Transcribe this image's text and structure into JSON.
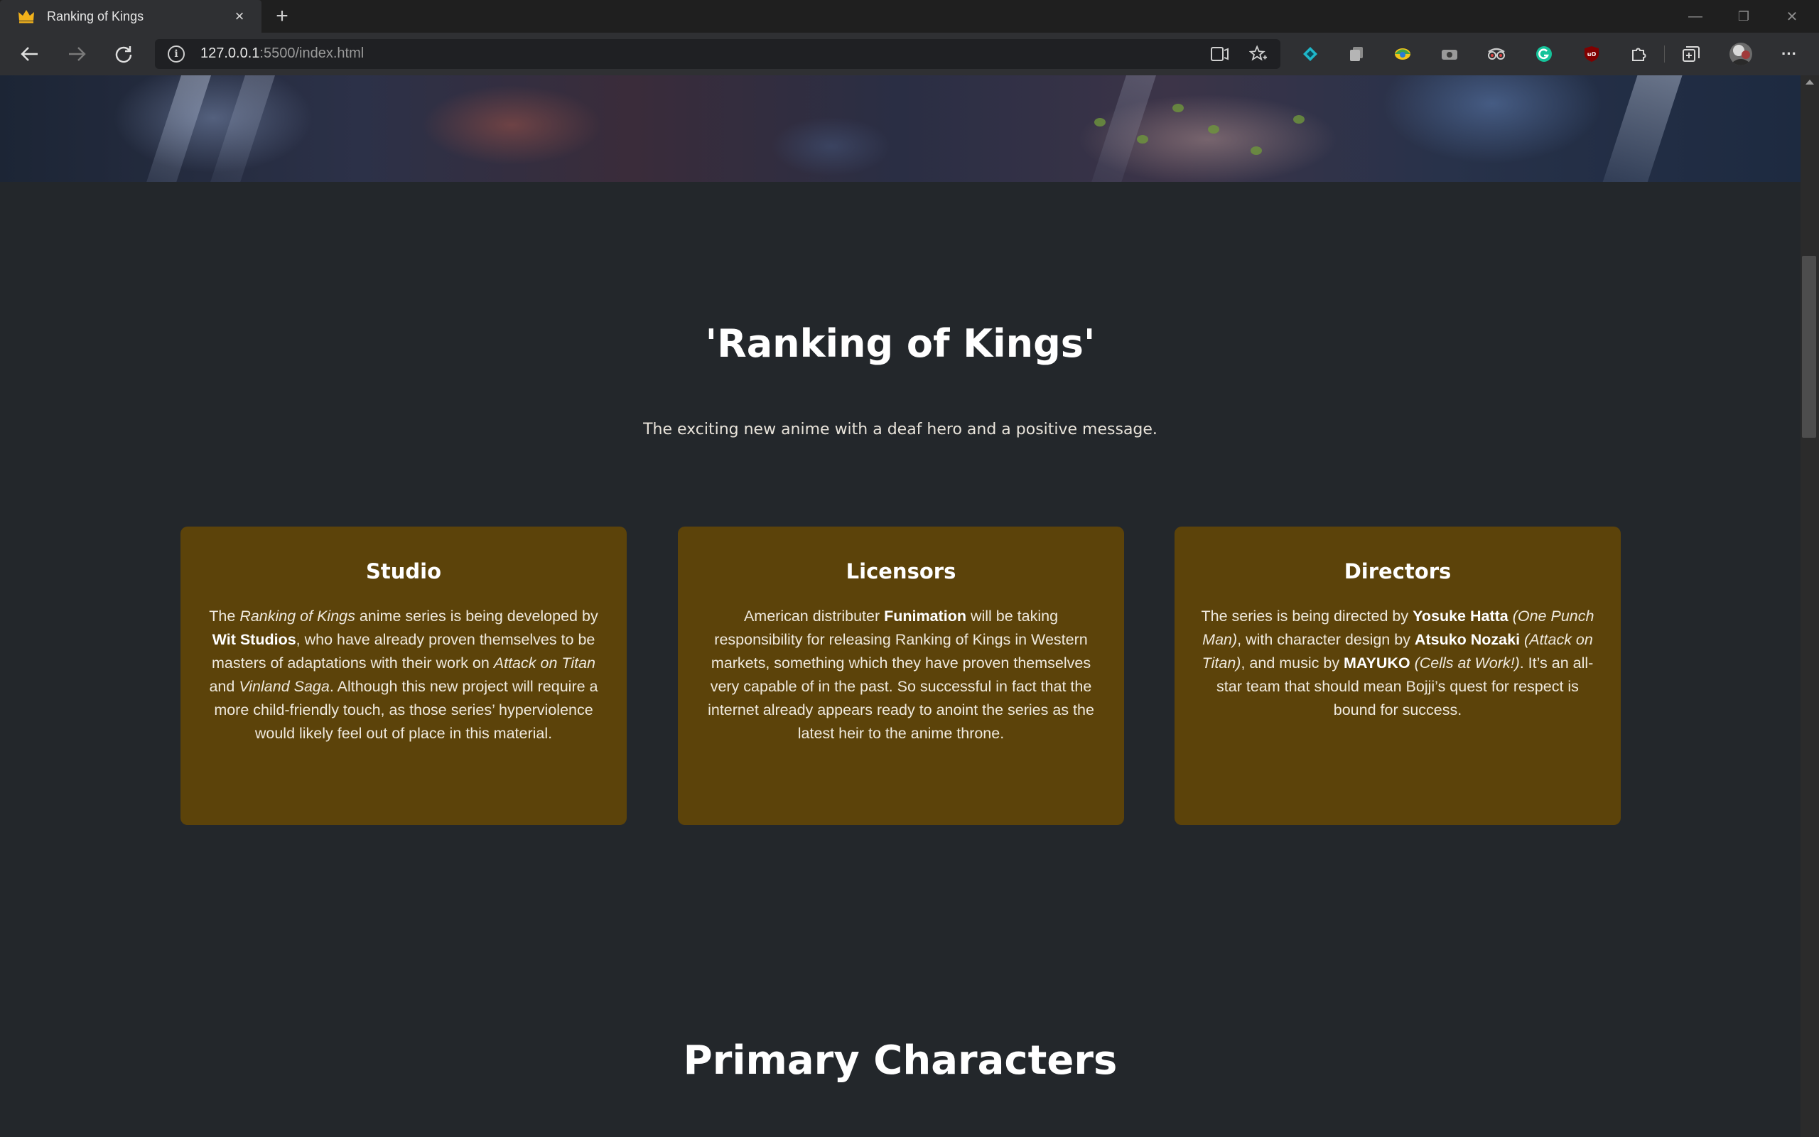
{
  "window": {
    "tab_title": "Ranking of Kings",
    "favicon": "crown-icon",
    "tab_close": "×",
    "new_tab": "+",
    "controls": {
      "minimize": "—",
      "restore": "❐",
      "close": "✕"
    }
  },
  "toolbar": {
    "url_host": "127.0.0.1",
    "url_rest": ":5500/index.html",
    "extensions": [
      "extension-teal-icon",
      "extension-copy-icon",
      "extension-colorful-icon",
      "extension-camera-icon",
      "extension-glasses-icon",
      "grammarly-icon",
      "ublock-icon",
      "puzzle-icon",
      "collections-icon",
      "profile-avatar",
      "more-icon"
    ],
    "more_label": "···"
  },
  "page": {
    "title": "'Ranking of Kings'",
    "subtitle": "The exciting new anime with a deaf hero and a positive message.",
    "cards": [
      {
        "title": "Studio",
        "t1": "The ",
        "i1": "Ranking of Kings",
        "t2": " anime series is being developed by ",
        "b1": "Wit Studios",
        "t3": ", who have already proven themselves to be masters of adaptations with their work on ",
        "i2": "Attack on Titan",
        "t4": " and ",
        "i3": "Vinland Saga",
        "t5": ". Although this new project will require a more child-friendly touch, as those series’ hyperviolence would likely feel out of place in this material."
      },
      {
        "title": "Licensors",
        "t1": "American distributer ",
        "b1": "Funimation",
        "t2": " will be taking responsibility for releasing Ranking of Kings in Western markets, something which they have proven themselves very capable of in the past. So successful in fact that the internet already appears ready to anoint the series as the latest heir to the anime throne."
      },
      {
        "title": "Directors",
        "t1": "The series is being directed by ",
        "b1": "Yosuke Hatta",
        "i1": " (One Punch Man)",
        "t2": ", with character design by ",
        "b2": "Atsuko Nozaki",
        "i2": " (Attack on Titan)",
        "t3": ", and music by ",
        "b3": "MAYUKO",
        "i3": " (Cells at Work!)",
        "t4": ". It’s an all-star team that should mean Bojji’s quest for respect is bound for success."
      }
    ],
    "section2_title": "Primary Characters"
  },
  "colors": {
    "page_bg": "#23272b",
    "card_bg": "#5c430a",
    "chrome_bg": "#2f3033"
  }
}
